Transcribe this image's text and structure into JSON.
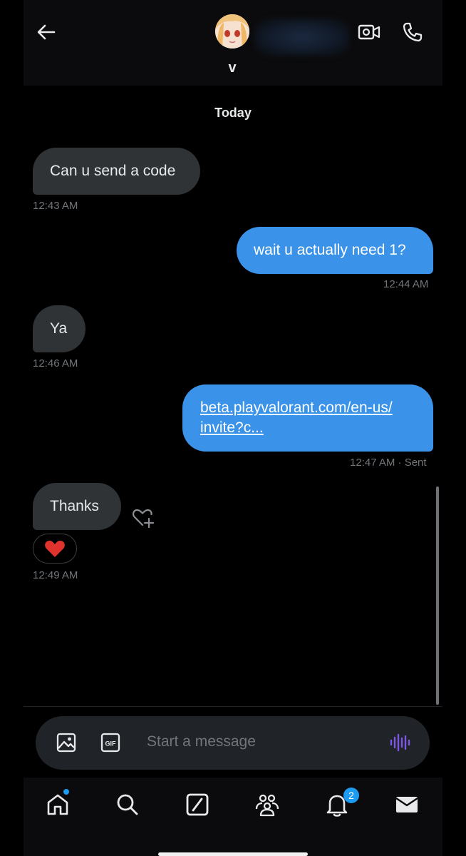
{
  "header": {
    "contact_name": "v",
    "icons": [
      "back-arrow-icon",
      "video-call-icon",
      "phone-icon"
    ]
  },
  "conversation": {
    "date_label": "Today",
    "messages": [
      {
        "direction": "incoming",
        "text": "Can u send a code",
        "time": "12:43 AM"
      },
      {
        "direction": "outgoing",
        "text": "wait u actually need 1?",
        "time": "12:44 AM"
      },
      {
        "direction": "incoming",
        "text": "Ya",
        "time": "12:46 AM"
      },
      {
        "direction": "outgoing",
        "link_line1": "beta.playvalorant.com/en-us/",
        "link_line2": "invite?c...",
        "time": "12:47 AM · Sent"
      },
      {
        "direction": "incoming",
        "text": "Thanks",
        "time": "12:49 AM",
        "reaction": "❤️"
      }
    ]
  },
  "composer": {
    "placeholder": "Start a message",
    "gif_label": "GIF"
  },
  "nav": {
    "notification_count": "2"
  },
  "colors": {
    "background": "#000000",
    "incoming_bubble": "#2f3336",
    "outgoing_bubble": "#3a93e8",
    "accent": "#1d9bf0"
  }
}
